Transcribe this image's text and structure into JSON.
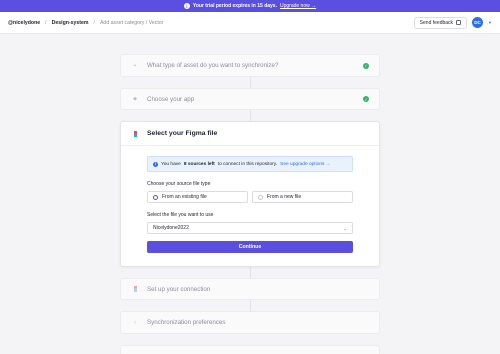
{
  "banner": {
    "text_prefix": "Your trial period expires in 15 days.",
    "link": "Upgrade now →"
  },
  "topbar": {
    "workspace": "@nicelydone",
    "repo": "Design-system",
    "page": "Add asset category / Vector",
    "feedback_label": "Send feedback",
    "avatar_initials": "DC"
  },
  "steps": [
    {
      "title": "What type of asset do you want to synchronize?",
      "done": true
    },
    {
      "title": "Choose your app",
      "done": true
    },
    {
      "title": "Select your Figma file",
      "done": false
    },
    {
      "title": "Set up your connection",
      "done": false
    },
    {
      "title": "Synchronization preferences",
      "done": false
    }
  ],
  "active": {
    "notice_prefix": "You have",
    "notice_bold": "8 sources left",
    "notice_suffix": "to connect in this repository.",
    "notice_link": "See upgrade options →",
    "source_label": "Choose your source file type",
    "option_existing": "From an existing file",
    "option_new": "From a new file",
    "file_label": "Select the file you want to use",
    "file_value": "Nicelydone2022",
    "continue_label": "Continue"
  },
  "colors": {
    "accent": "#5b4fe0",
    "success": "#34b36b",
    "info": "#2f6fe6"
  }
}
